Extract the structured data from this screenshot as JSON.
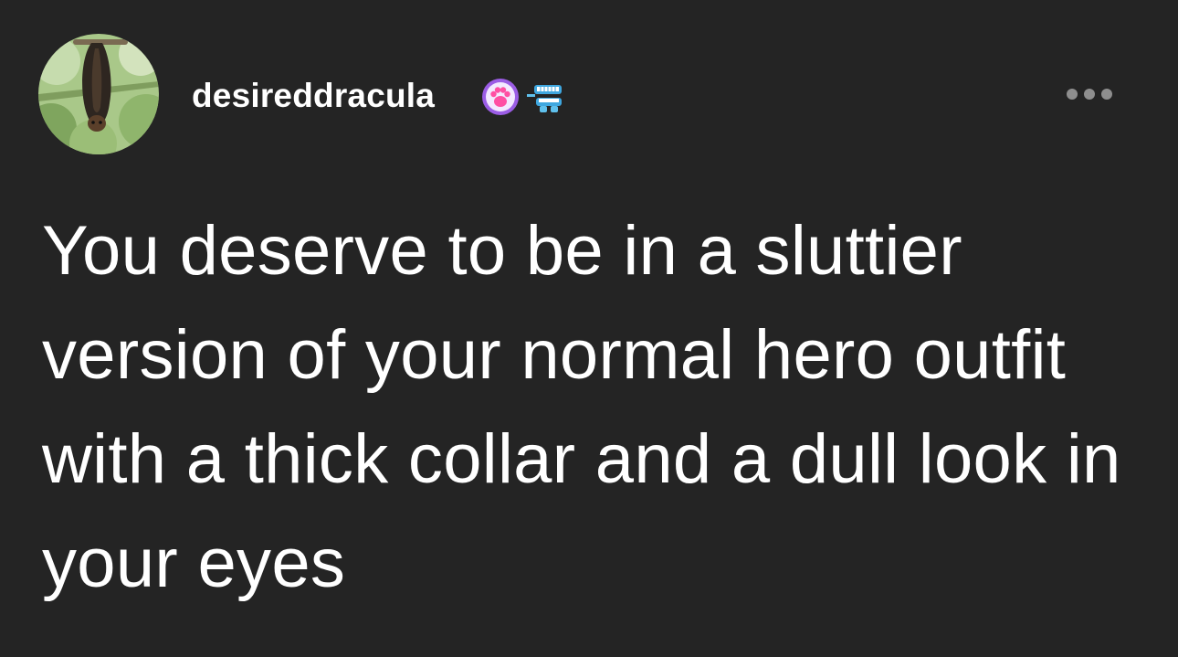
{
  "post": {
    "author": {
      "username": "desireddracula",
      "avatar_icon": "bat-avatar-icon",
      "badges": [
        {
          "icon": "paw-badge-icon"
        },
        {
          "icon": "chattering-teeth-badge-icon"
        }
      ]
    },
    "menu_icon": "more-options-icon",
    "text": "You deserve to be in a sluttier version of your normal hero outfit with a thick collar and a dull look in your eyes"
  },
  "colors": {
    "background": "#242424",
    "text": "#ffffff",
    "muted": "#8e8e8e",
    "paw_badge_bg": "#9b5de5",
    "paw_badge_paw": "#ff4fa3"
  }
}
